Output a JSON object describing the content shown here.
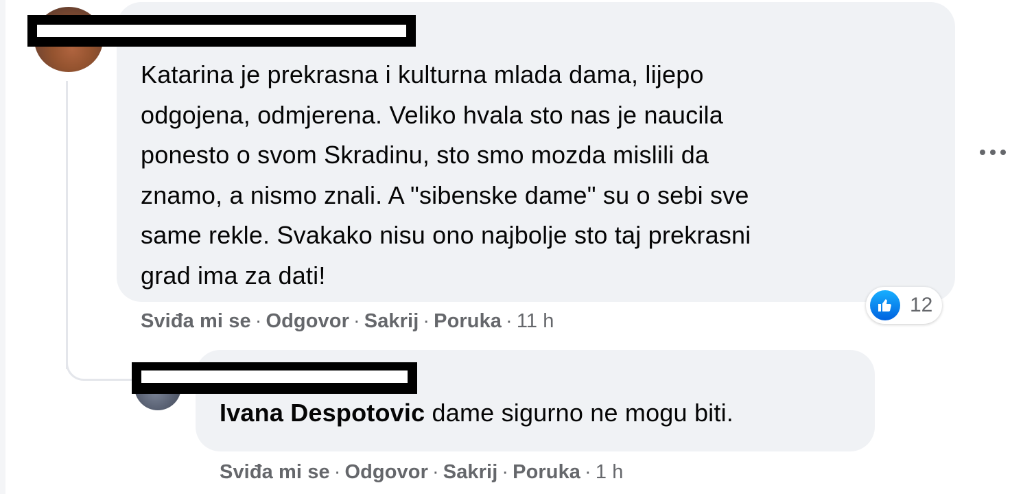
{
  "comment": {
    "lines": [
      "Katarina je prekrasna i kulturna mlada dama, lijepo",
      "odgojena, odmjerena. Veliko hvala sto nas je naucila",
      "ponesto o svom Skradinu, sto smo mozda mislili da",
      "znamo, a nismo znali. A \"sibenske dame\" su o sebi sve",
      "same rekle. Svakako nisu ono najbolje sto taj prekrasni",
      "grad ima za dati!"
    ],
    "actions": {
      "like": "Sviđa mi se",
      "reply": "Odgovor",
      "hide": "Sakrij",
      "message": "Poruka",
      "time": "11 h"
    },
    "reaction": {
      "icon": "like-icon",
      "count": "12",
      "color": "#1877f2"
    }
  },
  "reply": {
    "tagged_name": "Ivana Despotovic",
    "text": "dame sigurno ne mogu biti.",
    "actions": {
      "like": "Sviđa mi se",
      "reply": "Odgovor",
      "hide": "Sakrij",
      "message": "Poruka",
      "time": "1 h"
    }
  },
  "separator": "·",
  "more_icon": "more-horizontal-icon",
  "colors": {
    "bubble": "#f0f2f5",
    "meta_text": "#65676b",
    "text": "#050505"
  }
}
